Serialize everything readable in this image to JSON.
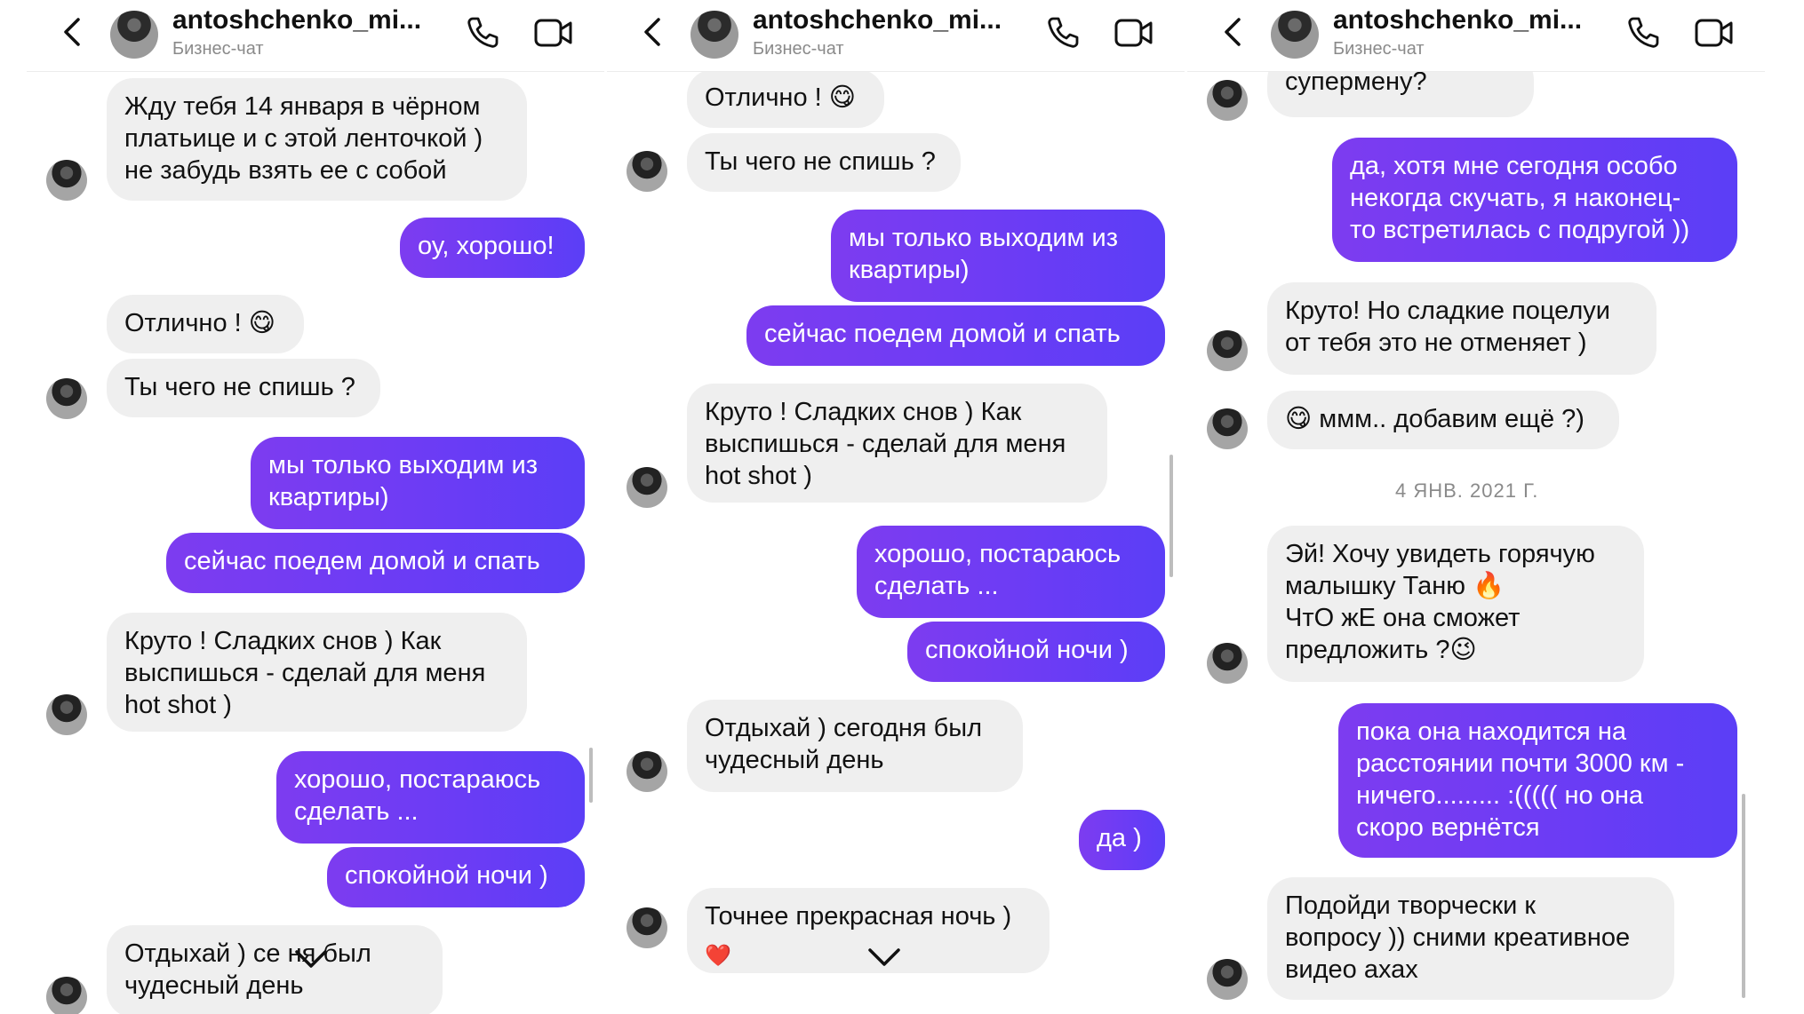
{
  "header": {
    "username": "antoshchenko_mi...",
    "subtitle": "Бизнес-чат"
  },
  "panels": [
    {
      "messages": [
        {
          "from": "in",
          "text": "Жду тебя 14 января в чёрном\nплатьице и с этой ленточкой )\nне забудь взять ее с собой"
        },
        {
          "from": "out",
          "text": "оу, хорошо!"
        },
        {
          "from": "in",
          "text": "Отлично ! 😋"
        },
        {
          "from": "in",
          "text": "Ты чего не спишь ?"
        },
        {
          "from": "out",
          "text": "мы только выходим из\nквартиры)"
        },
        {
          "from": "out",
          "text": "сейчас поедем домой и спать"
        },
        {
          "from": "in",
          "text": "Круто ! Сладких снов ) Как\nвыспишься - сделай для меня\nhot shot )"
        },
        {
          "from": "out",
          "text": "хорошо, постараюсь\nсделать ..."
        },
        {
          "from": "out",
          "text": "спокойной ночи )"
        },
        {
          "from": "in",
          "text": "Отдыхай ) се     ня был\nчудесный день"
        }
      ]
    },
    {
      "messages": [
        {
          "from": "in",
          "text": "Отлично ! 😋"
        },
        {
          "from": "in",
          "text": "Ты чего не спишь ?"
        },
        {
          "from": "out",
          "text": "мы только выходим из\nквартиры)"
        },
        {
          "from": "out",
          "text": "сейчас поедем домой и спать"
        },
        {
          "from": "in",
          "text": "Круто ! Сладких снов ) Как\nвыспишься - сделай для меня\nhot shot )"
        },
        {
          "from": "out",
          "text": "хорошо, постараюсь\nсделать ..."
        },
        {
          "from": "out",
          "text": "спокойной ночи )"
        },
        {
          "from": "in",
          "text": "Отдыхай ) сегодня был\nчудесный день"
        },
        {
          "from": "out",
          "text": "да )"
        },
        {
          "from": "in",
          "text": "Точнее прекрасная ночь )"
        },
        {
          "reaction": "❤️"
        }
      ]
    },
    {
      "messages": [
        {
          "from": "in",
          "text": "супермену?"
        },
        {
          "from": "out",
          "text": "да, хотя мне сегодня особо\nнекогда скучать, я наконец-\nто встретилась  с подругой ))"
        },
        {
          "from": "in",
          "text": "Круто! Но сладкие поцелуи\nот тебя это не отменяет )"
        },
        {
          "from": "in",
          "text": "😋 ммм.. добавим ещё ?)"
        },
        {
          "date": "4 ЯНВ. 2021 Г."
        },
        {
          "from": "in",
          "text": "Эй! Хочу увидеть горячую\nмалышку Таню 🔥\nЧтО жЕ она сможет\nпредложить ?😉"
        },
        {
          "from": "out",
          "text": "пока она находится на\nрасстоянии почти 3000 км -\nничего......... :((((( но она\nскоро вернётся"
        },
        {
          "from": "in",
          "text": "Подойди творчески к\nвопросу )) сними креативное\nвидео ахах"
        }
      ]
    }
  ]
}
